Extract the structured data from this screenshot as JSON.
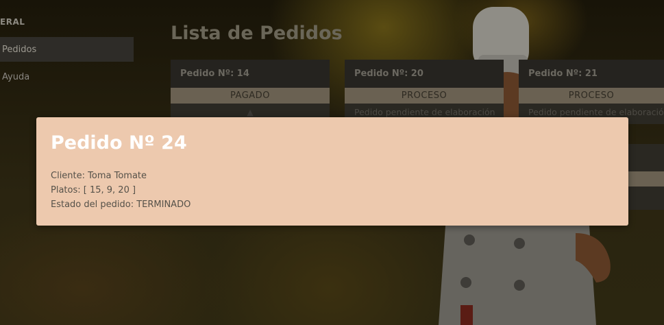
{
  "sidebar": {
    "section_title": "ERAL",
    "items": [
      {
        "label": "Pedidos",
        "active": true
      },
      {
        "label": "Ayuda",
        "active": false
      }
    ]
  },
  "main": {
    "title": "Lista de Pedidos",
    "orders": [
      {
        "header": "Pedido Nº: 14",
        "status": "PAGADO",
        "body": ""
      },
      {
        "header": "Pedido Nº: 20",
        "status": "PROCESO",
        "body": "Pedido pendiente de elaboración"
      },
      {
        "header": "Pedido Nº: 21",
        "status": "PROCESO",
        "body": "Pedido pendiente de elaboración"
      }
    ]
  },
  "modal": {
    "title": "Pedido Nº 24",
    "cliente": "Cliente: Toma Tomate",
    "platos": "Platos: [ 15, 9, 20 ]",
    "estado": "Estado del pedido: TERMINADO"
  },
  "colors": {
    "modal_bg": "#edc9ae",
    "modal_title": "#ffffff",
    "status_bar": "#6a6152"
  }
}
